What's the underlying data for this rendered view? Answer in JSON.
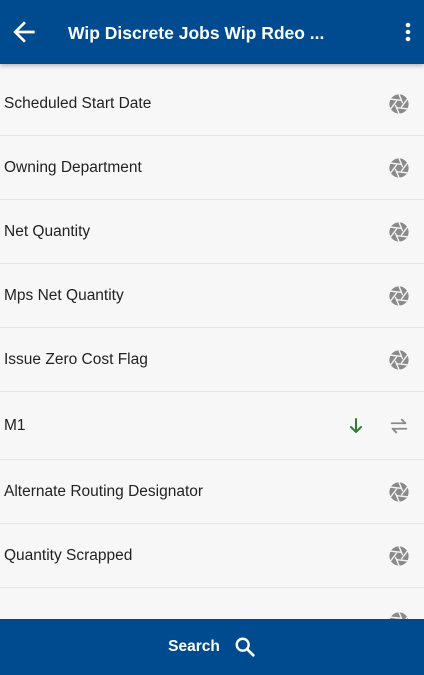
{
  "appbar": {
    "title": "Wip Discrete Jobs Wip Rdeo ..."
  },
  "fields": [
    {
      "label": "Scheduled Start Date",
      "icon": "aperture-icon"
    },
    {
      "label": "Owning Department",
      "icon": "aperture-icon"
    },
    {
      "label": "Net Quantity",
      "icon": "aperture-icon"
    },
    {
      "label": "Mps Net Quantity",
      "icon": "aperture-icon"
    },
    {
      "label": "Issue Zero Cost Flag",
      "icon": "aperture-icon"
    },
    {
      "label": "M1",
      "icon": "swap-arrows-icon",
      "sort": "arrow-down-icon"
    },
    {
      "label": "Alternate Routing Designator",
      "icon": "aperture-icon"
    },
    {
      "label": "Quantity Scrapped",
      "icon": "aperture-icon"
    }
  ],
  "bottombar": {
    "search_label": "Search"
  },
  "colors": {
    "primary": "#004a8f",
    "icon_gray": "#8a8a8a",
    "sort_green": "#2e7d32"
  }
}
